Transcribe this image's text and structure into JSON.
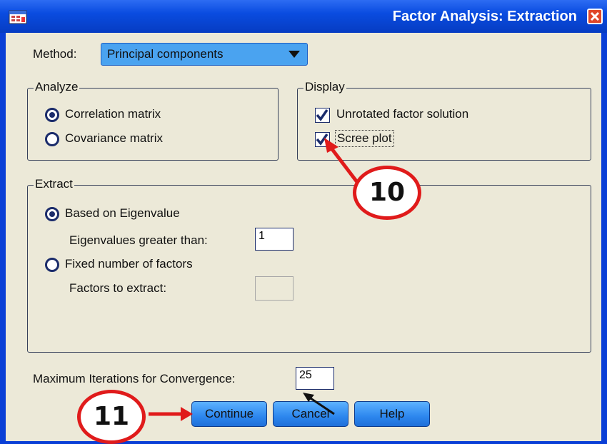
{
  "window": {
    "title": "Factor Analysis: Extraction"
  },
  "method": {
    "label": "Method:",
    "value": "Principal components"
  },
  "analyze": {
    "legend": "Analyze",
    "options": [
      "Correlation matrix",
      "Covariance matrix"
    ],
    "selected": 0
  },
  "display": {
    "legend": "Display",
    "unrotated_label": "Unrotated factor solution",
    "unrotated_checked": true,
    "scree_label": "Scree plot",
    "scree_checked": true
  },
  "extract": {
    "legend": "Extract",
    "eigen_radio_label": "Based on Eigenvalue",
    "eigen_label": "Eigenvalues greater than:",
    "eigen_value": "1",
    "fixed_radio_label": "Fixed number of factors",
    "factors_label": "Factors to extract:",
    "factors_value": ""
  },
  "iterations": {
    "label": "Maximum Iterations for Convergence:",
    "value": "25"
  },
  "buttons": {
    "continue": "Continue",
    "cancel": "Cancel",
    "help": "Help"
  },
  "annotations": {
    "step10": "10",
    "step11": "11",
    "arrow_color": "#e01b1b"
  },
  "colors": {
    "titlebar": "#0a4ce0",
    "button": "#2d87ee",
    "dialog_bg": "#ece9d8"
  }
}
